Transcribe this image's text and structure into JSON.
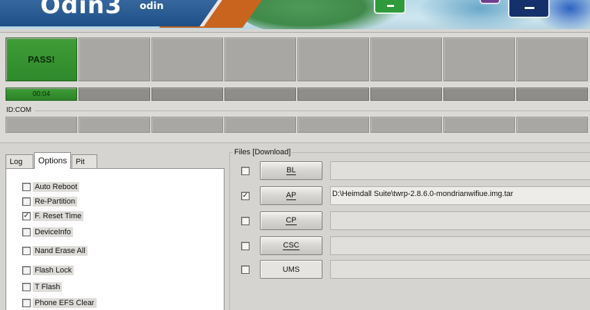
{
  "header": {
    "title": "Odin3",
    "subtitle": "odin"
  },
  "status": {
    "port_message": "PASS!",
    "elapsed_time": "00:04",
    "idcom_label": "ID:COM"
  },
  "tabs": [
    {
      "label": "Log",
      "active": false
    },
    {
      "label": "Options",
      "active": true
    },
    {
      "label": "Pit",
      "active": false
    }
  ],
  "options": [
    {
      "label": "Auto Reboot",
      "checked": false
    },
    {
      "label": "Re-Partition",
      "checked": false
    },
    {
      "label": "F. Reset Time",
      "checked": true
    },
    {
      "label": "DeviceInfo",
      "checked": false
    },
    {
      "label": "Nand Erase All",
      "checked": false
    },
    {
      "label": "Flash Lock",
      "checked": false
    },
    {
      "label": "T Flash",
      "checked": false
    },
    {
      "label": "Phone EFS Clear",
      "checked": false
    }
  ],
  "files": {
    "group_label": "Files [Download]",
    "rows": [
      {
        "button": "BL",
        "checked": false,
        "path": ""
      },
      {
        "button": "AP",
        "checked": true,
        "path": "D:\\Heimdall Suite\\twrp-2.8.6.0-mondrianwifiue.img.tar"
      },
      {
        "button": "CP",
        "checked": false,
        "path": ""
      },
      {
        "button": "CSC",
        "checked": false,
        "path": ""
      },
      {
        "button": "UMS",
        "checked": false,
        "path": ""
      }
    ]
  },
  "colors": {
    "pass_green": "#3f9d37",
    "panel_gray": "#a9a7a4",
    "banner_blue": "#1f4f86"
  },
  "icons": {
    "check_mark": "✓"
  }
}
